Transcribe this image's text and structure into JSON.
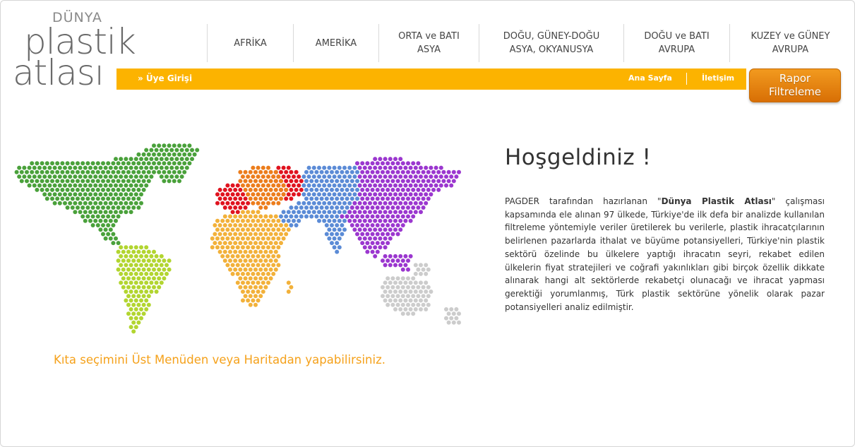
{
  "logo": {
    "top": "DÜNYA",
    "line1": "plastik",
    "line2": "atlası"
  },
  "nav": [
    {
      "label": "AFRİKA"
    },
    {
      "label": "AMERİKA"
    },
    {
      "label": "ORTA ve BATI\nASYA"
    },
    {
      "label": "DOĞU, GÜNEY-DOĞU\nASYA, OKYANUSYA"
    },
    {
      "label": "DOĞU ve BATI\nAVRUPA"
    },
    {
      "label": "KUZEY ve GÜNEY\nAVRUPA"
    }
  ],
  "bar": {
    "login": "» Üye Girişi",
    "home": "Ana Sayfa",
    "contact": "İletişim"
  },
  "report_button": "Rapor\nFiltreleme",
  "map": {
    "hint": "Kıta seçimini Üst Menüden veya Haritadan yapabilirsiniz.",
    "regions": [
      {
        "name": "north-america",
        "color": "#4aa13b"
      },
      {
        "name": "south-america",
        "color": "#b2d530"
      },
      {
        "name": "europe-west",
        "color": "#e0131f"
      },
      {
        "name": "europe-east",
        "color": "#ec7d1c"
      },
      {
        "name": "africa",
        "color": "#f2b13a"
      },
      {
        "name": "middle-asia",
        "color": "#5b8bd6"
      },
      {
        "name": "east-asia",
        "color": "#9b37cf"
      },
      {
        "name": "oceania",
        "color": "#cccccc"
      }
    ]
  },
  "welcome": {
    "title": "Hoşgeldiniz !",
    "p_before": "PAGDER tarafından hazırlanan \"",
    "p_bold": "Dünya Plastik Atlası",
    "p_after": "\" çalışması kapsamında ele alınan 97 ülkede, Türkiye'de ilk defa bir analizde kullanılan filtreleme yöntemiyle veriler üretilerek bu verilerle, plastik ihracatçılarının belirlenen pazarlarda ithalat ve büyüme potansiyelleri, Türkiye'nin plastik sektörü özelinde bu ülkelere yaptığı ihracatın seyri, rekabet edilen ülkelerin fiyat stratejileri ve coğrafi yakınlıkları gibi birçok özellik dikkate alınarak hangi alt sektörlerde rekabetçi olunacağı ve ihracat yapması gerektiği yorumlanmış, Türk plastik sektörüne yönelik olarak pazar potansiyelleri analiz edilmiştir."
  }
}
